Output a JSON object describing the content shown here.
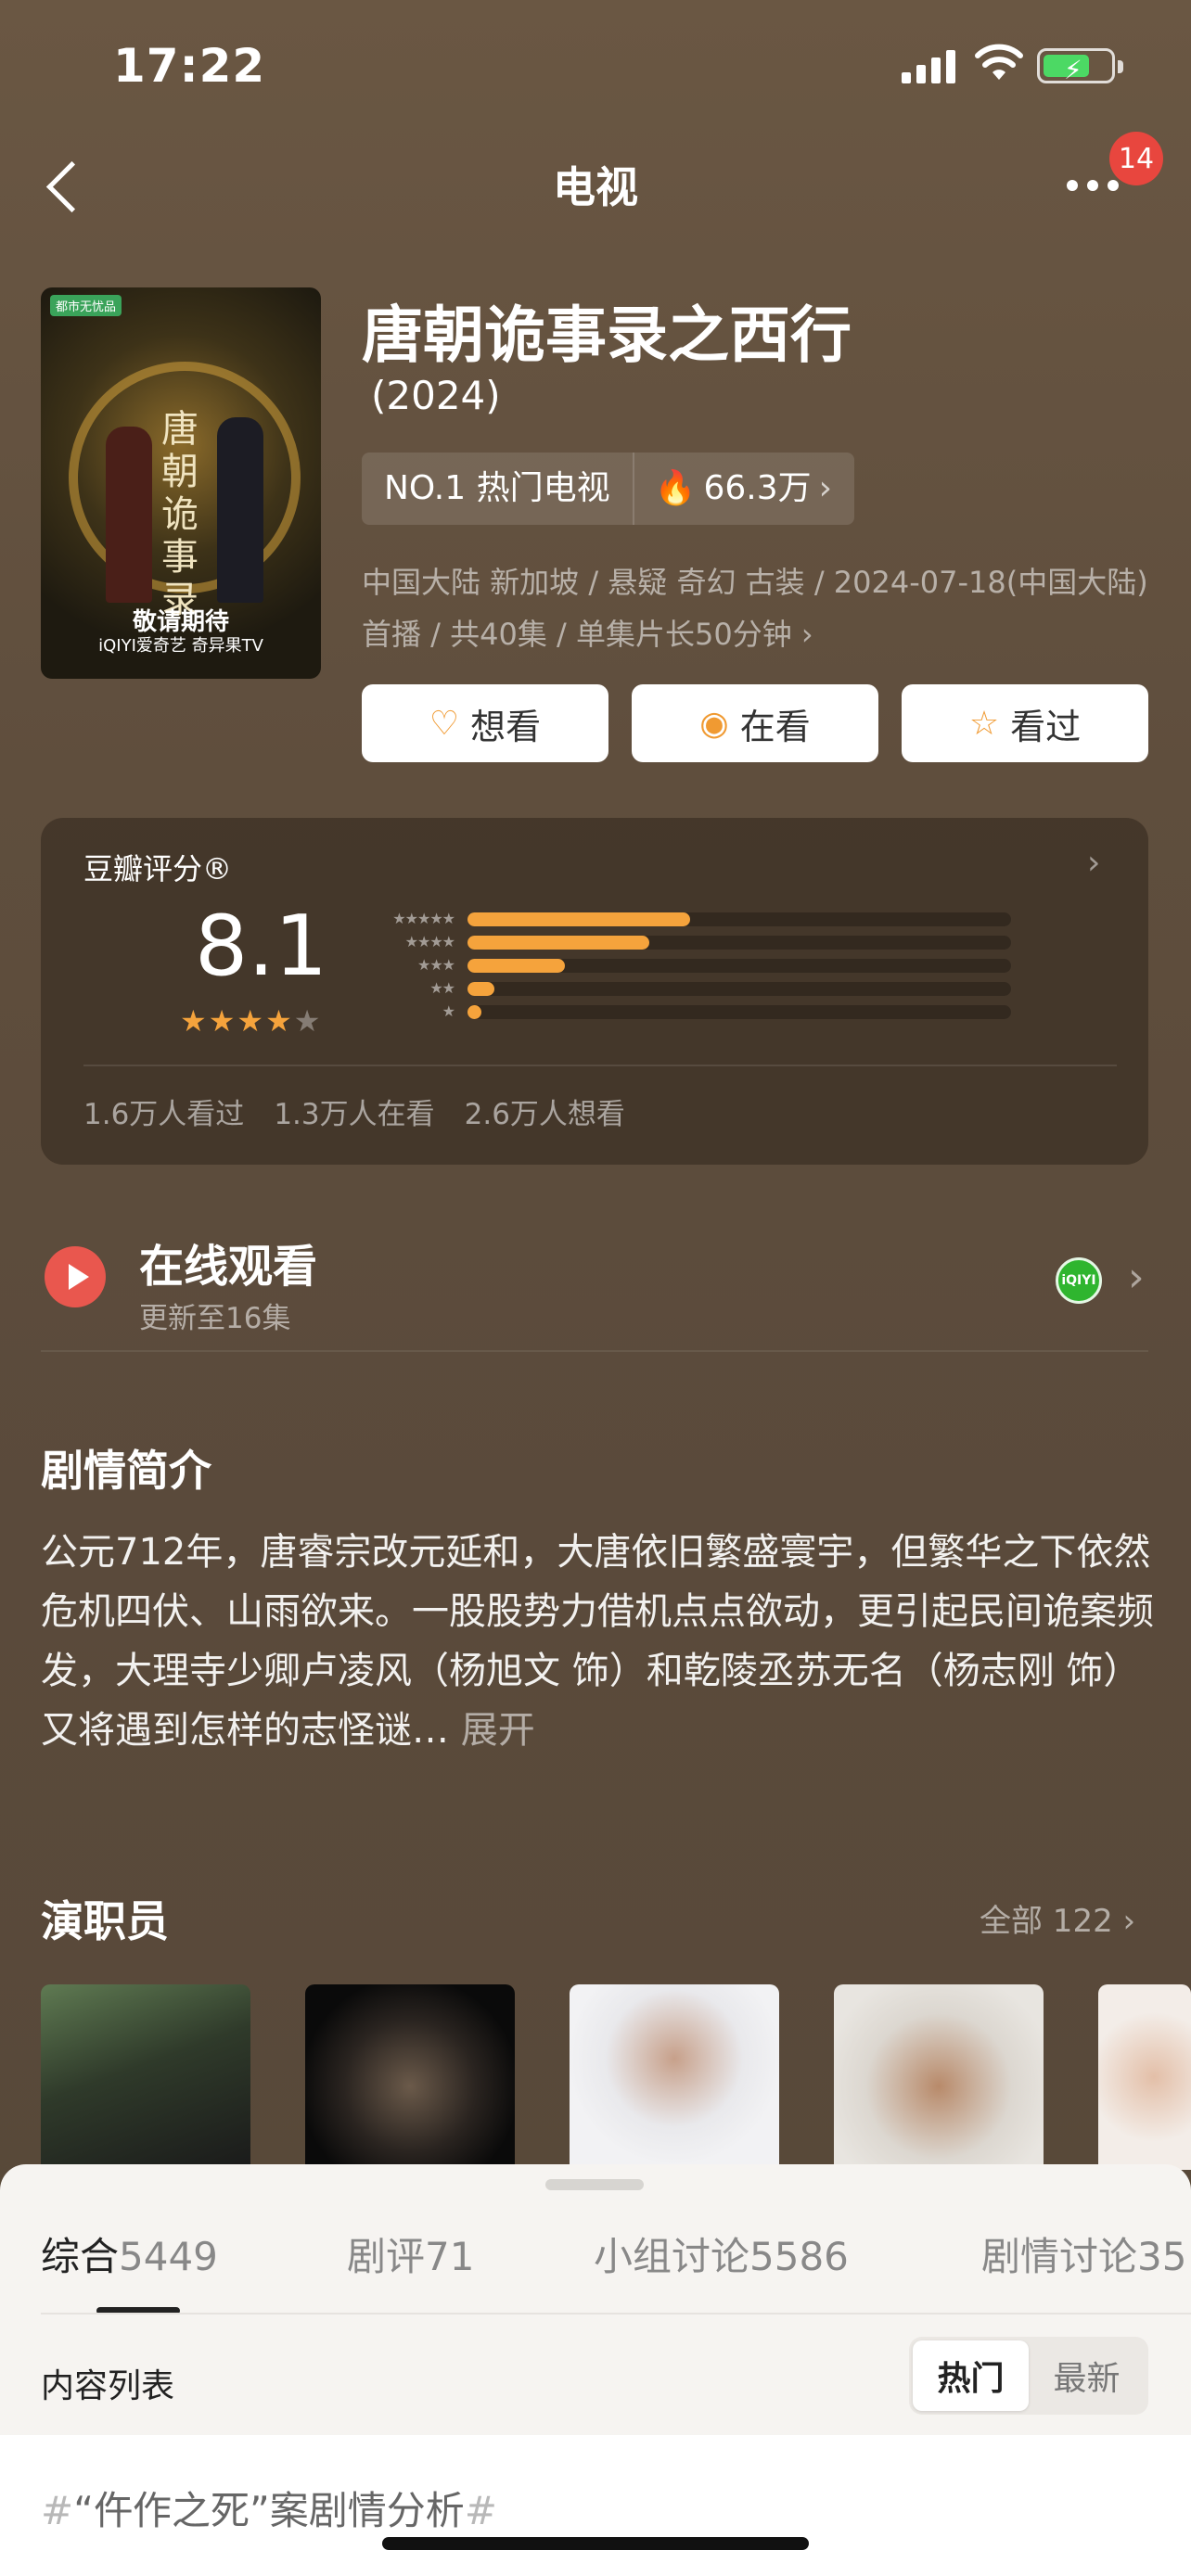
{
  "status_bar": {
    "time": "17:22"
  },
  "nav": {
    "title": "电视",
    "notification_count": "14"
  },
  "poster": {
    "tag": "都市无忧品",
    "calligraphy": "唐朝诡事录",
    "caption": "敬请期待",
    "footer": "iQIYI爱奇艺  奇异果TV"
  },
  "show": {
    "title": "唐朝诡事录之西行",
    "year": "(2024)",
    "rank": "NO.1 热门电视",
    "heat": "66.3万",
    "meta": "中国大陆 新加坡 / 悬疑 奇幻 古装 / 2024-07-18(中国大陆) 首播 / 共40集 / 单集片长50分钟"
  },
  "actions": {
    "want": "想看",
    "watching": "在看",
    "watched": "看过"
  },
  "rating": {
    "label": "豆瓣评分®",
    "score": "8.1",
    "stars": 4,
    "star_labels": [
      "★★★★★",
      "★★★★",
      "★★★",
      "★★",
      "★"
    ],
    "distribution": [
      0.41,
      0.335,
      0.18,
      0.05,
      0.025
    ],
    "stats": [
      "1.6万人看过",
      "1.3万人在看",
      "2.6万人想看"
    ]
  },
  "online": {
    "title": "在线观看",
    "subtitle": "更新至16集",
    "provider": "iQIYI"
  },
  "synopsis": {
    "title": "剧情简介",
    "text": "公元712年，唐睿宗改元延和，大唐依旧繁盛寰宇，但繁华之下依然危机四伏、山雨欲来。一股股势力借机点点欲动，更引起民间诡案频发，大理寺少卿卢凌风（杨旭文 饰）和乾陵丞苏无名（杨志刚 饰）又将遇到怎样的志怪谜…",
    "more": "展开"
  },
  "cast": {
    "title": "演职员",
    "all": "全部 122"
  },
  "sheet": {
    "tabs": [
      {
        "label": "综合",
        "count": "5449"
      },
      {
        "label": "剧评",
        "count": "71"
      },
      {
        "label": "小组讨论",
        "count": "5586"
      },
      {
        "label": "剧情讨论",
        "count": "35"
      }
    ],
    "content_label": "内容列表",
    "sort_hot": "热门",
    "sort_new": "最新",
    "post_hash_open": "#",
    "post_title": "“仵作之死”案剧情分析",
    "post_hash_close": "#"
  },
  "colors": {
    "accent": "#f5a33c",
    "badge": "#e8463e",
    "play": "#e9574e",
    "iqiyi": "#2fb52f"
  }
}
